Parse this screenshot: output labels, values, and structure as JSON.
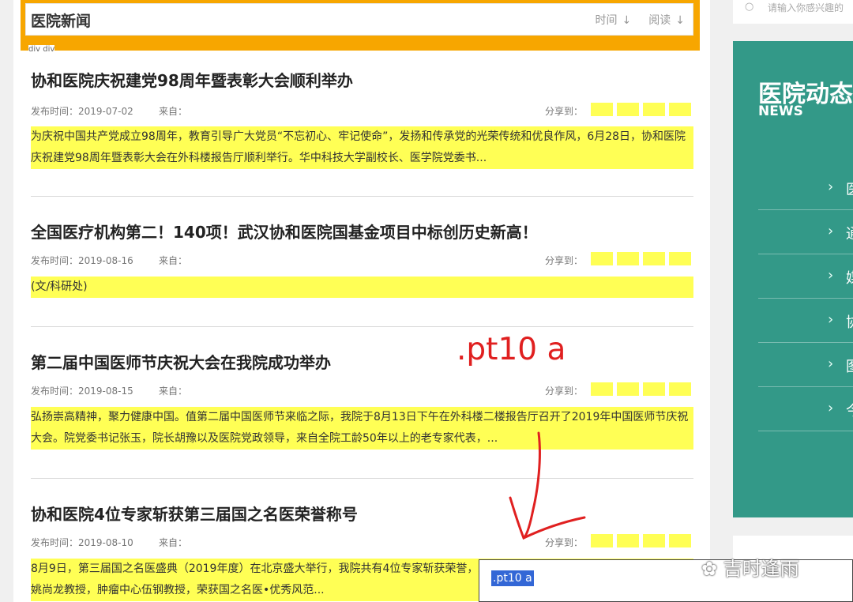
{
  "header": {
    "title": "医院新闻",
    "sort_time": "时间",
    "sort_read": "阅读",
    "arrow": "↓"
  },
  "div_tag": "div div",
  "articles": [
    {
      "title": "协和医院庆祝建党98周年暨表彰大会顺利举办",
      "date": "发布时间：2019-07-02",
      "from": "来自：",
      "share": "分享到：",
      "summary": "为庆祝中国共产党成立98周年，教育引导广大党员“不忘初心、牢记使命”，发扬和传承党的光荣传统和优良作风，6月28日，协和医院庆祝建党98周年暨表彰大会在外科楼报告厅顺利举行。华中科技大学副校长、医学院党委书..."
    },
    {
      "title": "全国医疗机构第二！140项！武汉协和医院国基金项目中标创历史新高！",
      "date": "发布时间：2019-08-16",
      "from": "来自：",
      "share": "分享到：",
      "summary": "(文/科研处)"
    },
    {
      "title": "第二届中国医师节庆祝大会在我院成功举办",
      "date": "发布时间：2019-08-15",
      "from": "来自：",
      "share": "分享到：",
      "summary": "弘扬崇高精神，聚力健康中国。值第二届中国医师节来临之际，我院于8月13日下午在外科楼二楼报告厅召开了2019年中国医师节庆祝大会。院党委书记张玉，院长胡豫以及医院党政领导，来自全院工龄50年以上的老专家代表，..."
    },
    {
      "title": "协和医院4位专家斩获第三届国之名医荣誉称号",
      "date": "发布时间：2019-08-10",
      "from": "来自：",
      "share": "分享到：",
      "summary": "8月9日，第三届国之名医盛典（2019年度）在北京盛大举行，我院共有4位专家斩获荣誉，荣获国之名医•卓越建树荣誉称号的麻醉科姚尚龙教授，肿瘤中心伍钢教授，荣获国之名医•优秀风范..."
    }
  ],
  "annotation": ".pt10 a",
  "tooltip_text": ".pt10 a",
  "search": {
    "placeholder": "请输入你感兴趣的"
  },
  "news_panel": {
    "title_cn": "医院动态",
    "title_en": "NEWS",
    "items": [
      "医",
      "通",
      "媒",
      "协",
      "图",
      "今"
    ]
  },
  "watermark": "吉时逢雨",
  "colors": {
    "accent_orange": "#f7a600",
    "highlight_yellow": "#ffff55",
    "panel_teal": "#339988",
    "annotation_red": "#e02020"
  }
}
